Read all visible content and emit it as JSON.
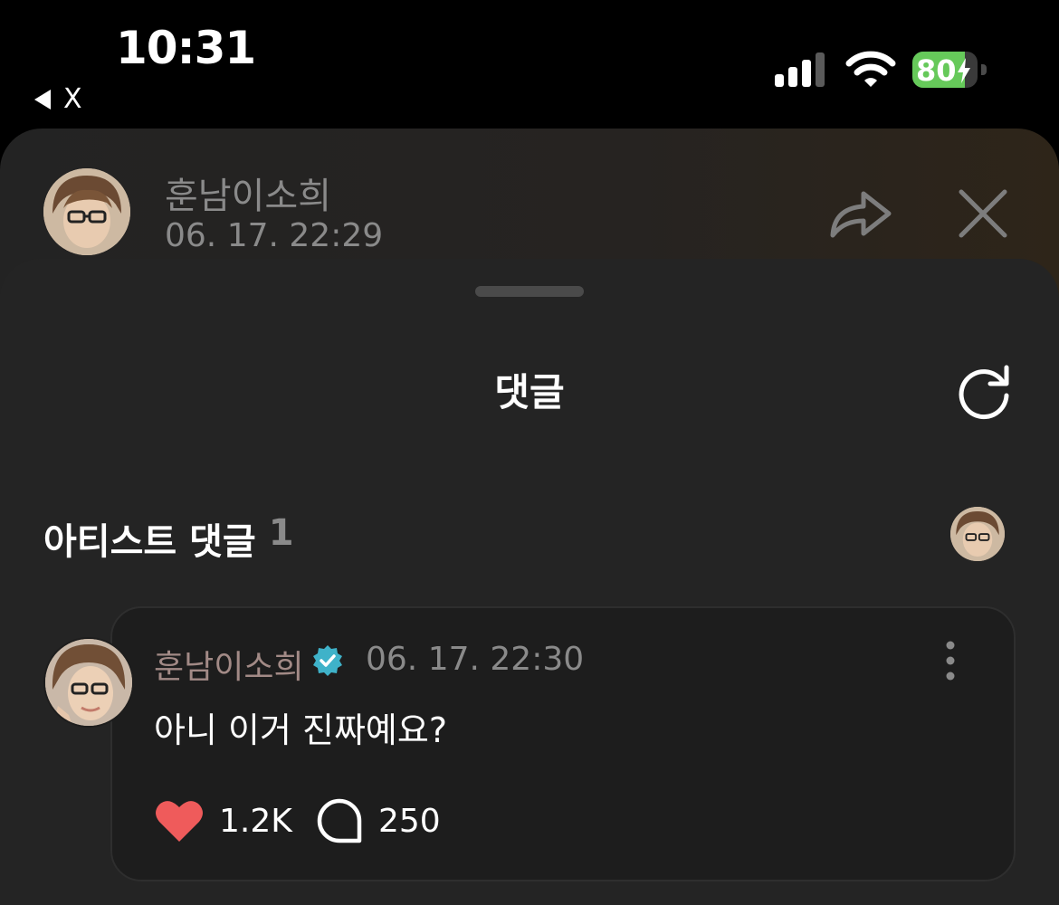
{
  "status_bar": {
    "time": "10:31",
    "back_label": "X",
    "battery_level": "80",
    "battery_fraction": 0.8,
    "battery_color": "#66c95a",
    "icons": [
      "back-arrow-icon",
      "cellular-signal-icon",
      "wifi-icon",
      "battery-charging-icon"
    ]
  },
  "post_header": {
    "author": "훈남이소희",
    "timestamp": "06. 17. 22:29",
    "icons": [
      "avatar",
      "share-icon",
      "close-icon"
    ]
  },
  "sheet": {
    "title": "댓글",
    "icons": [
      "drag-handle",
      "refresh-icon"
    ]
  },
  "artist_section": {
    "title": "아티스트 댓글",
    "count": "1"
  },
  "comment": {
    "author": "훈남이소희",
    "author_color": "#a28a86",
    "verified_color": "#3fb2c9",
    "timestamp": "06. 17. 22:30",
    "text": "아니 이거 진짜예요?",
    "likes": "1.2K",
    "like_color": "#ef5b5b",
    "replies": "250",
    "icons": [
      "verified-badge-icon",
      "more-vertical-icon",
      "heart-icon",
      "comment-bubble-icon"
    ]
  }
}
